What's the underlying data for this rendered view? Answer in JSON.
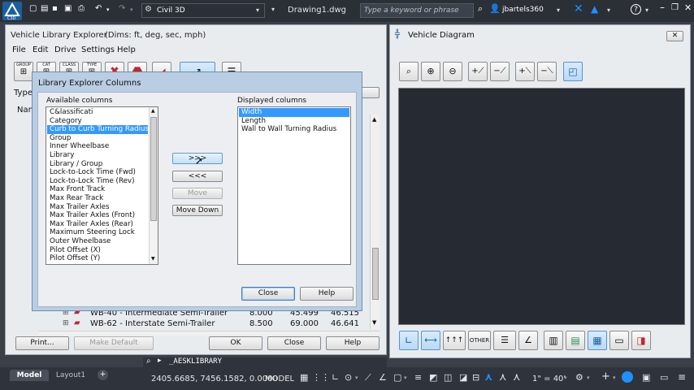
{
  "app": {
    "workspace": "Civil 3D",
    "doc_title": "Drawing1.dwg",
    "search_placeholder": "Type a keyword or phrase",
    "user": "jbartels360"
  },
  "vle": {
    "title": "Vehicle Library Explorer",
    "dims": "(Dims: ft, deg, sec, mph)",
    "menu": [
      "File",
      "Edit",
      "Drive",
      "Settings",
      "Help"
    ],
    "type_label": "Type",
    "name_label": "Nam",
    "tb_labels": [
      "GROUP",
      "CAT",
      "CLASS",
      "TYPE"
    ],
    "rows": [
      {
        "name": "WB-40 - Intermediate Semi-Trailer",
        "width": "8.000",
        "length": "45.499",
        "wall": "46.515"
      },
      {
        "name": "WB-62 - Interstate Semi-Trailer",
        "width": "8.500",
        "length": "69.000",
        "wall": "46.641"
      }
    ],
    "btn_print": "Print...",
    "btn_default": "Make Default",
    "btn_ok": "OK",
    "btn_close": "Close",
    "btn_help": "Help"
  },
  "cols_dialog": {
    "title": "Library Explorer Columns",
    "available_label": "Available columns",
    "displayed_label": "Displayed columns",
    "available": [
      "C&lassificati",
      "Category",
      "Curb to Curb Turning Radius",
      "Group",
      "Inner Wheelbase",
      "Library",
      "Library / Group",
      "Lock-to-Lock Time (Fwd)",
      "Lock-to-Lock Time (Rev)",
      "Max Front Track",
      "Max Rear Track",
      "Max Trailer Axles",
      "Max Trailer Axles (Front)",
      "Max Trailer Axles (Rear)",
      "Maximum Steering Lock",
      "Outer Wheelbase",
      "Pilot Offset (X)",
      "Pilot Offset (Y)"
    ],
    "available_selected": "Curb to Curb Turning Radius",
    "displayed": [
      "Width",
      "Length",
      "Wall to Wall Turning Radius"
    ],
    "displayed_selected": "Width",
    "btn_add": ">>>",
    "btn_remove": "<<<",
    "btn_move": "Move",
    "btn_move_down": "Move Down",
    "btn_close": "Close",
    "btn_help": "Help"
  },
  "diagram": {
    "title": "Vehicle Diagram",
    "canvas_color": "#252a33"
  },
  "statusbar": {
    "tabs": [
      "Model",
      "Layout1"
    ],
    "coords": "2405.6685, 7456.1582, 0.0000",
    "mode": "MODEL",
    "scale": "1\" = 40'",
    "command_text": "_AESKLIBRARY"
  },
  "colors": {
    "titlebar": "#2b2f36",
    "selection": "#3399ff",
    "accent": "#1e90ff"
  }
}
